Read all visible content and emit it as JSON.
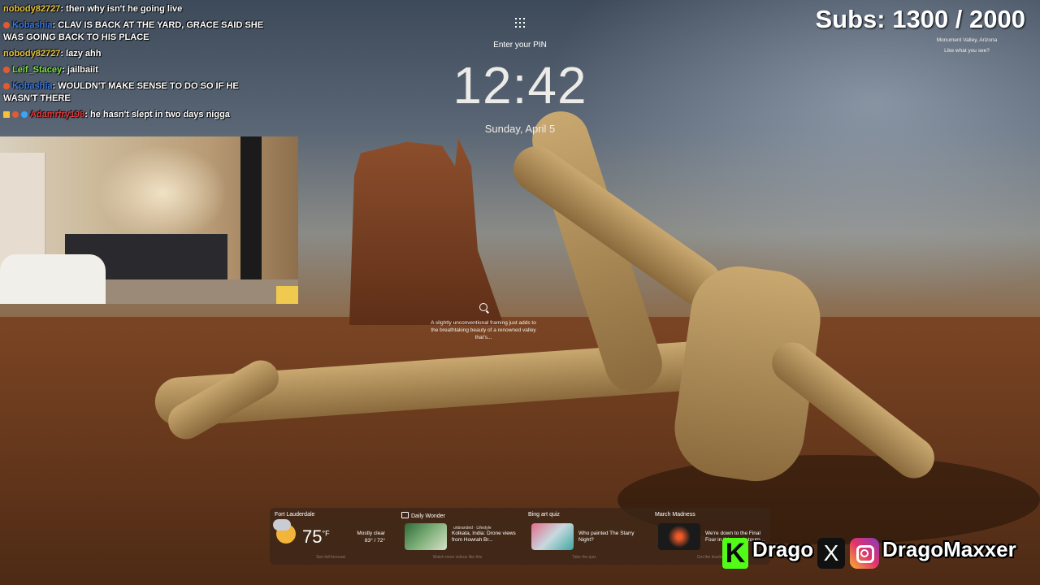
{
  "chat": {
    "messages": [
      {
        "user": "nobody82727",
        "user_color": "#e8c33b",
        "text": "then why isn't he going live",
        "badges": []
      },
      {
        "user": "Kobashia",
        "user_color": "#3a7ae8",
        "text": "CLAV IS BACK AT THE YARD, GRACE SAID SHE WAS GOING BACK TO HIS PLACE",
        "badges": [
          "flame"
        ]
      },
      {
        "user": "nobody82727",
        "user_color": "#e8c33b",
        "text": "lazy ahh",
        "badges": []
      },
      {
        "user": "Leif_Stacey",
        "user_color": "#7ee04a",
        "text": "jailbaiit",
        "badges": [
          "flame"
        ]
      },
      {
        "user": "Kobashia",
        "user_color": "#3a7ae8",
        "text": "WOULDN'T MAKE SENSE TO DO SO IF HE WASN'T THERE",
        "badges": [
          "flame"
        ]
      },
      {
        "user": "Adamrfry198",
        "user_color": "#e23a3a",
        "text": "he hasn't slept in two days nigga",
        "badges": [
          "crown",
          "flame",
          "gem"
        ]
      }
    ]
  },
  "subs_counter": {
    "text": "Subs: 1300 / 2000"
  },
  "lockscreen": {
    "pin_prompt": "Enter your PIN",
    "time": "12:42",
    "date": "Sunday, April 5",
    "location": "Monument Valley, Arizona",
    "like_prompt": "Like what you see?",
    "caption": "A slightly unconventional framing just adds to the breathtaking beauty of a renowned valley that's..."
  },
  "widgets": [
    {
      "title": "Fort Lauderdale",
      "temp": "75",
      "unit": "°F",
      "condition": "Mostly clear",
      "range": "83° / 72°",
      "footer": "See full forecast"
    },
    {
      "title": "Daily Wonder",
      "source": "unbranded · Lifestyle",
      "text": "Kolkata, India: Drone views from Howrah Br...",
      "footer": "Watch more videos like this"
    },
    {
      "title": "Bing art quiz",
      "text": "Who painted The Starry Night?",
      "footer": "Take the quiz"
    },
    {
      "title": "March Madness",
      "text": "We're down to the Final Four in this year's tourn...",
      "footer": "Get the bracket"
    }
  ],
  "social": {
    "kick_name": "Drago",
    "x_label": "X",
    "instagram_name": "DragoMaxxer"
  },
  "colors": {
    "kick_green": "#53fc18",
    "widget_bg": "#3a2618"
  },
  "icons": [
    "apps-grid-icon",
    "search-icon",
    "weather-icon",
    "kick-icon",
    "x-icon",
    "instagram-icon"
  ]
}
